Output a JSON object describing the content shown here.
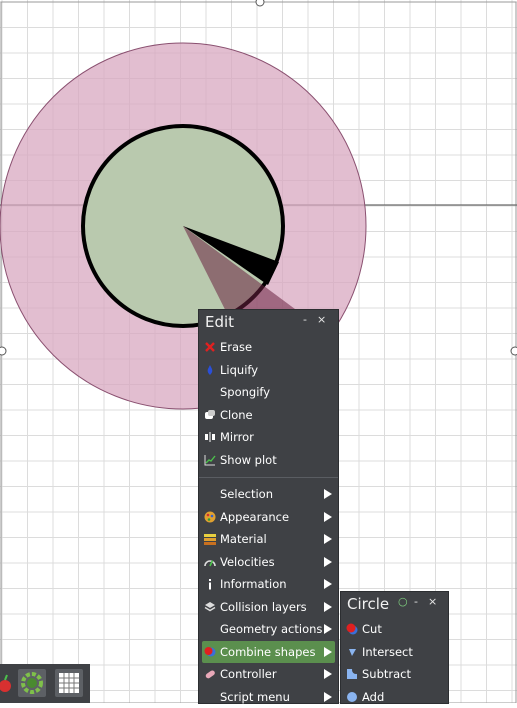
{
  "edit_menu": {
    "title": "Edit",
    "minimize": "-",
    "close": "×",
    "items": [
      {
        "label": "Erase",
        "icon": "erase-icon"
      },
      {
        "label": "Liquify",
        "icon": "liquify-icon"
      },
      {
        "label": "Spongify",
        "icon": ""
      },
      {
        "label": "Clone",
        "icon": "clone-icon"
      },
      {
        "label": "Mirror",
        "icon": "mirror-icon"
      },
      {
        "label": "Show plot",
        "icon": "plot-icon"
      }
    ],
    "submenus": [
      {
        "label": "Selection",
        "icon": ""
      },
      {
        "label": "Appearance",
        "icon": "appearance-icon"
      },
      {
        "label": "Material",
        "icon": "material-icon"
      },
      {
        "label": "Velocities",
        "icon": "velocities-icon"
      },
      {
        "label": "Information",
        "icon": "information-icon"
      },
      {
        "label": "Collision layers",
        "icon": "layers-icon"
      },
      {
        "label": "Geometry actions",
        "icon": ""
      },
      {
        "label": "Combine shapes",
        "icon": "combine-icon",
        "highlighted": true
      },
      {
        "label": "Controller",
        "icon": "controller-icon"
      },
      {
        "label": "Script menu",
        "icon": ""
      }
    ]
  },
  "circle_menu": {
    "title": "Circle",
    "pin": "○",
    "minimize": "-",
    "close": "×",
    "items": [
      {
        "label": "Cut",
        "icon": "cut-icon"
      },
      {
        "label": "Intersect",
        "icon": "intersect-icon"
      },
      {
        "label": "Subtract",
        "icon": "subtract-icon"
      },
      {
        "label": "Add",
        "icon": "add-icon"
      }
    ]
  },
  "toolbar": {
    "buttons": [
      {
        "icon": "apple-icon"
      },
      {
        "icon": "gear-icon"
      },
      {
        "icon": "grid-icon"
      }
    ]
  },
  "colors": {
    "outer_circle": "#d8a8c0",
    "inner_circle": "#b9c9ae",
    "menu_bg": "#3f4145",
    "highlight": "#5b8f4e"
  }
}
